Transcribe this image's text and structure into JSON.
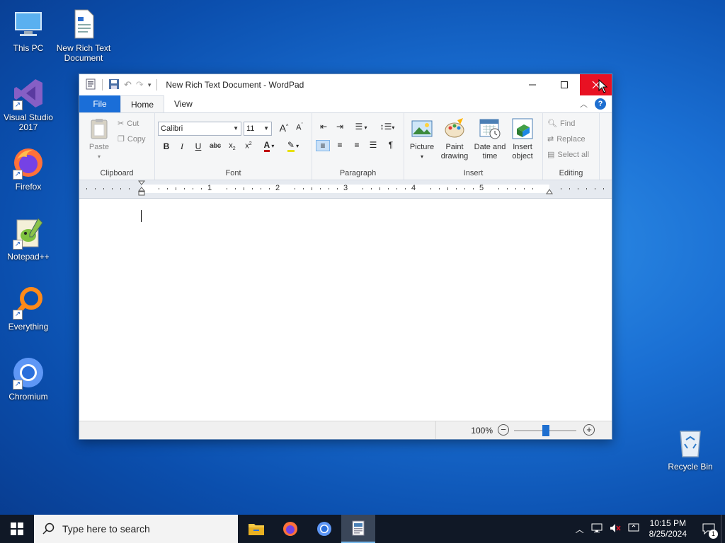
{
  "desktop": {
    "icons": [
      {
        "label": "This PC",
        "icon": "this-pc-icon"
      },
      {
        "label": "New Rich Text Document",
        "icon": "rtf-document-icon"
      },
      {
        "label": "Visual Studio 2017",
        "icon": "visual-studio-icon"
      },
      {
        "label": "Firefox",
        "icon": "firefox-icon"
      },
      {
        "label": "Notepad++",
        "icon": "notepadpp-icon"
      },
      {
        "label": "Everything",
        "icon": "everything-icon"
      },
      {
        "label": "Chromium",
        "icon": "chromium-icon"
      },
      {
        "label": "Recycle Bin",
        "icon": "recycle-bin-icon"
      }
    ]
  },
  "window": {
    "title": "New Rich Text Document - WordPad",
    "tabs": [
      "File",
      "Home",
      "View"
    ],
    "active_tab": "Home",
    "clipboard": {
      "paste": "Paste",
      "cut": "Cut",
      "copy": "Copy",
      "label": "Clipboard"
    },
    "font": {
      "family": "Calibri",
      "size": "11",
      "label": "Font"
    },
    "paragraph": {
      "label": "Paragraph"
    },
    "insert": {
      "picture": "Picture",
      "paint_line1": "Paint",
      "paint_line2": "drawing",
      "datetime_line1": "Date and",
      "datetime_line2": "time",
      "object_line1": "Insert",
      "object_line2": "object",
      "label": "Insert"
    },
    "editing": {
      "find": "Find",
      "replace": "Replace",
      "select_all": "Select all",
      "label": "Editing"
    },
    "ruler_numbers": [
      "1",
      "2",
      "3",
      "4",
      "5"
    ],
    "status": {
      "zoom": "100%"
    }
  },
  "taskbar": {
    "search_placeholder": "Type here to search",
    "time": "10:15 PM",
    "date": "8/25/2024",
    "notification_count": "1"
  },
  "colors": {
    "accent": "#1a6ed8",
    "close_button": "#e81123",
    "taskbar": "#101826"
  }
}
